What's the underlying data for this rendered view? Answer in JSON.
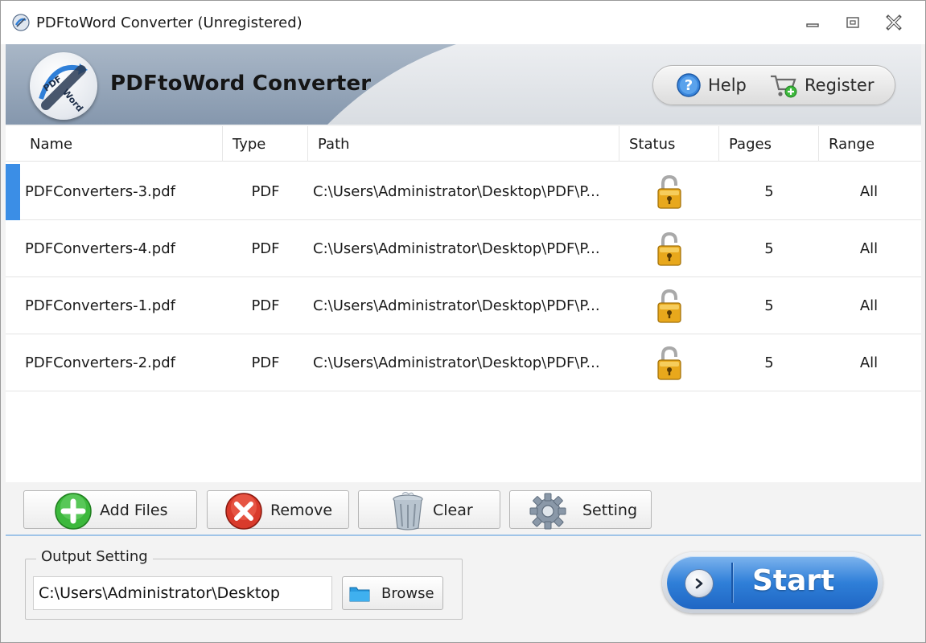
{
  "window": {
    "title": "PDFtoWord Converter (Unregistered)"
  },
  "banner": {
    "app_title": "PDFtoWord Converter",
    "logo_text_top": "PDF",
    "logo_text_bottom": "Word",
    "help_label": "Help",
    "register_label": "Register"
  },
  "table": {
    "headers": {
      "name": "Name",
      "type": "Type",
      "path": "Path",
      "status": "Status",
      "pages": "Pages",
      "range": "Range"
    },
    "rows": [
      {
        "name": "PDFConverters-3.pdf",
        "type": "PDF",
        "path": "C:\\Users\\Administrator\\Desktop\\PDF\\P...",
        "status": "unlocked-icon",
        "pages": "5",
        "range": "All",
        "selected": true
      },
      {
        "name": "PDFConverters-4.pdf",
        "type": "PDF",
        "path": "C:\\Users\\Administrator\\Desktop\\PDF\\P...",
        "status": "unlocked-icon",
        "pages": "5",
        "range": "All",
        "selected": false
      },
      {
        "name": "PDFConverters-1.pdf",
        "type": "PDF",
        "path": "C:\\Users\\Administrator\\Desktop\\PDF\\P...",
        "status": "unlocked-icon",
        "pages": "5",
        "range": "All",
        "selected": false
      },
      {
        "name": "PDFConverters-2.pdf",
        "type": "PDF",
        "path": "C:\\Users\\Administrator\\Desktop\\PDF\\P...",
        "status": "unlocked-icon",
        "pages": "5",
        "range": "All",
        "selected": false
      }
    ]
  },
  "toolbar": {
    "add_files_label": "Add Files",
    "remove_label": "Remove",
    "clear_label": "Clear",
    "setting_label": "Setting"
  },
  "output": {
    "legend": "Output Setting",
    "path_value": "C:\\Users\\Administrator\\Desktop",
    "browse_label": "Browse"
  },
  "start": {
    "label": "Start"
  },
  "colors": {
    "accent_blue": "#2f7fd8",
    "selection_bar": "#3b8ee6",
    "add_green": "#3cb83c",
    "remove_red": "#d93a2b",
    "lock_gold": "#e8a81c"
  }
}
